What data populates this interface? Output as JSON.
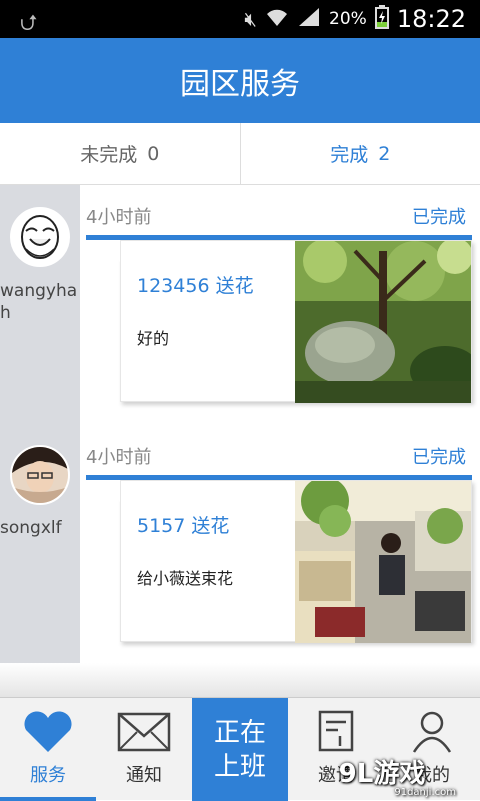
{
  "status_bar": {
    "battery": "20%",
    "time": "18:22"
  },
  "header": {
    "title": "园区服务"
  },
  "tabs": [
    {
      "label": "未完成",
      "count": "0",
      "active": false
    },
    {
      "label": "完成",
      "count": "2",
      "active": true
    }
  ],
  "entries": [
    {
      "username": "wangyhah",
      "time": "4小时前",
      "status": "已完成",
      "title": "123456 送花",
      "body": "好的"
    },
    {
      "username": "songxlf",
      "time": "4小时前",
      "status": "已完成",
      "title": "5157 送花",
      "body": "给小薇送束花"
    }
  ],
  "nav": {
    "items": [
      {
        "label": "服务",
        "icon": "heart-icon",
        "active": true
      },
      {
        "label": "通知",
        "icon": "envelope-icon",
        "active": false
      },
      {
        "label": "正在上班",
        "line1": "正在",
        "line2": "上班",
        "icon": "",
        "active": false
      },
      {
        "label": "邀请",
        "icon": "document-icon",
        "active": false
      },
      {
        "label": "我的",
        "icon": "person-icon",
        "active": false
      }
    ]
  },
  "watermark": {
    "text": "9L游戏",
    "sub": "91danji.com"
  },
  "colors": {
    "accent": "#2f80d6",
    "sidebar": "#d9dbe0"
  }
}
